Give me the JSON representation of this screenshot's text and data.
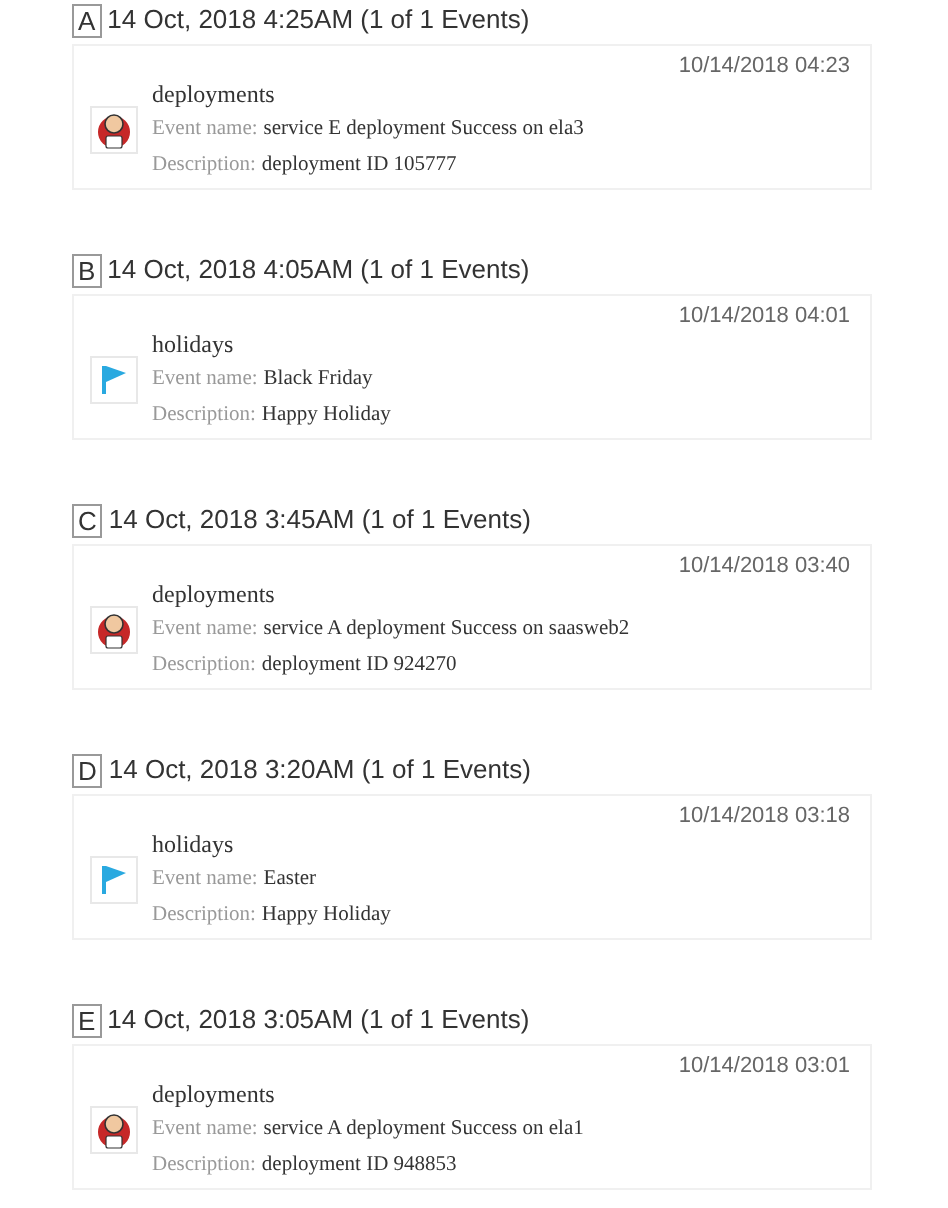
{
  "groups": [
    {
      "marker": "A",
      "heading": "14 Oct, 2018 4:25AM (1 of 1 Events)",
      "events": [
        {
          "timestamp": "10/14/2018 04:23",
          "kind": "deploy",
          "category": "deployments",
          "name_label": "Event name:",
          "name": "service E deployment Success on ela3",
          "description_label": "Description:",
          "description": "deployment ID 105777"
        }
      ]
    },
    {
      "marker": "B",
      "heading": "14 Oct, 2018 4:05AM (1 of 1 Events)",
      "events": [
        {
          "timestamp": "10/14/2018 04:01",
          "kind": "holiday",
          "category": "holidays",
          "name_label": "Event name:",
          "name": "Black Friday",
          "description_label": "Description:",
          "description": "Happy Holiday"
        }
      ]
    },
    {
      "marker": "C",
      "heading": "14 Oct, 2018 3:45AM (1 of 1 Events)",
      "events": [
        {
          "timestamp": "10/14/2018 03:40",
          "kind": "deploy",
          "category": "deployments",
          "name_label": "Event name:",
          "name": "service A deployment Success on saasweb2",
          "description_label": "Description:",
          "description": "deployment ID 924270"
        }
      ]
    },
    {
      "marker": "D",
      "heading": "14 Oct, 2018 3:20AM (1 of 1 Events)",
      "events": [
        {
          "timestamp": "10/14/2018 03:18",
          "kind": "holiday",
          "category": "holidays",
          "name_label": "Event name:",
          "name": "Easter",
          "description_label": "Description:",
          "description": "Happy Holiday"
        }
      ]
    },
    {
      "marker": "E",
      "heading": "14 Oct, 2018 3:05AM (1 of 1 Events)",
      "events": [
        {
          "timestamp": "10/14/2018 03:01",
          "kind": "deploy",
          "category": "deployments",
          "name_label": "Event name:",
          "name": "service A deployment Success on ela1",
          "description_label": "Description:",
          "description": "deployment ID 948853"
        }
      ]
    }
  ]
}
